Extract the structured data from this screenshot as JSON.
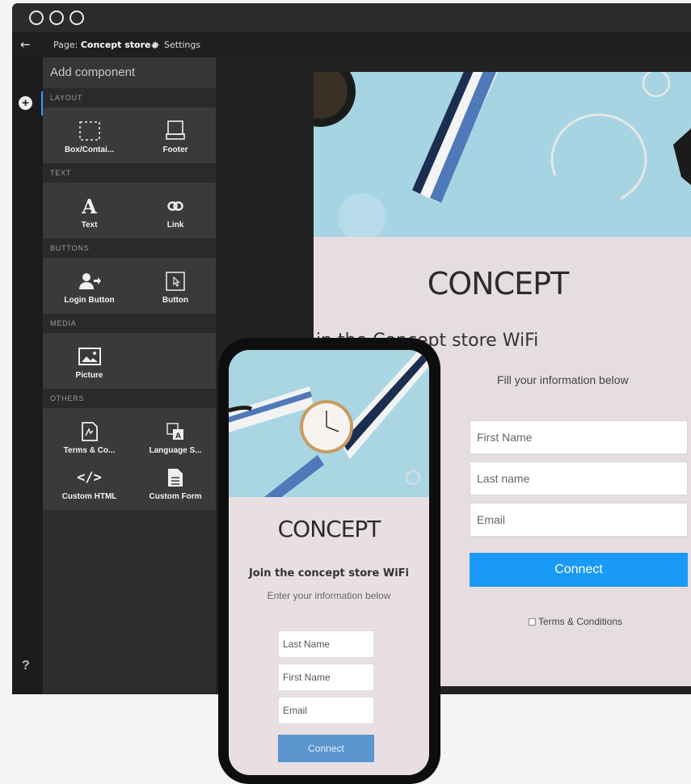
{
  "topbar": {
    "page_prefix": "Page:",
    "page_name": "Concept store",
    "settings_label": "Settings"
  },
  "panel": {
    "title": "Add component",
    "sections": [
      {
        "name": "LAYOUT",
        "items": [
          "Box/Contai...",
          "Footer"
        ]
      },
      {
        "name": "TEXT",
        "items": [
          "Text",
          "Link"
        ]
      },
      {
        "name": "BUTTONS",
        "items": [
          "Login Button",
          "Button"
        ]
      },
      {
        "name": "MEDIA",
        "items": [
          "Picture"
        ]
      },
      {
        "name": "OTHERS",
        "items": [
          "Terms & Co...",
          "Language S...",
          "Custom HTML",
          "Custom Form"
        ]
      }
    ]
  },
  "help_label": "?",
  "desktop_preview": {
    "brand": "CONCEPT",
    "heading": "Join the Concept store WiFi",
    "subheading": "Fill your information below",
    "fields": [
      "First Name",
      "Last name",
      "Email"
    ],
    "button": "Connect",
    "terms": "Terms & Conditions"
  },
  "mobile_preview": {
    "brand": "CONCEPT",
    "heading": "Join the concept store WiFi",
    "subheading": "Enter your information below",
    "fields": [
      "Last Name",
      "First Name",
      "Email"
    ],
    "button": "Connect"
  },
  "colors": {
    "accent": "#1a9af7",
    "panel_bg": "#2e2e2e",
    "preview_bg": "#e5dde1",
    "mobile_button": "#5a95ce"
  }
}
